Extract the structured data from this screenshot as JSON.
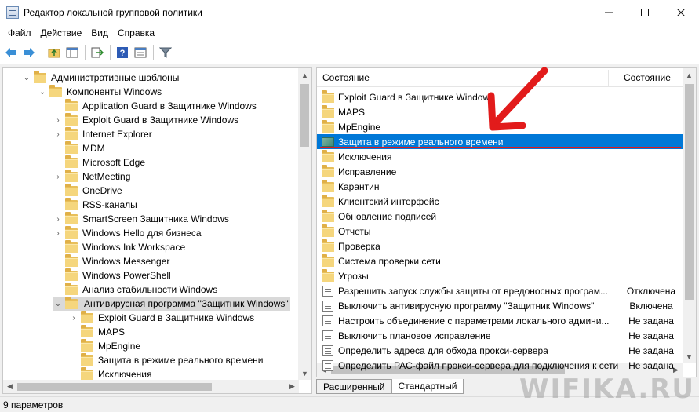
{
  "window": {
    "title": "Редактор локальной групповой политики",
    "controls": [
      "minimize-icon",
      "maximize-icon",
      "close-icon"
    ]
  },
  "menu": [
    "Файл",
    "Действие",
    "Вид",
    "Справка"
  ],
  "toolbar": [
    "back-arrow-icon",
    "forward-arrow-icon",
    "up-folder-icon",
    "console-tree-icon",
    "export-list-icon",
    "help-icon",
    "properties-icon",
    "filter-icon"
  ],
  "tree": [
    {
      "label": "Административные шаблоны",
      "expander": "⌄",
      "level": 0
    },
    {
      "label": "Компоненты Windows",
      "expander": "⌄",
      "level": 1
    },
    {
      "label": "Application Guard в Защитнике Windows",
      "expander": "",
      "level": 2
    },
    {
      "label": "Exploit Guard в Защитнике Windows",
      "expander": "›",
      "level": 2
    },
    {
      "label": "Internet Explorer",
      "expander": "›",
      "level": 2
    },
    {
      "label": "MDM",
      "expander": "",
      "level": 2
    },
    {
      "label": "Microsoft Edge",
      "expander": "",
      "level": 2
    },
    {
      "label": "NetMeeting",
      "expander": "›",
      "level": 2
    },
    {
      "label": "OneDrive",
      "expander": "",
      "level": 2
    },
    {
      "label": "RSS-каналы",
      "expander": "",
      "level": 2
    },
    {
      "label": "SmartScreen Защитника Windows",
      "expander": "›",
      "level": 2
    },
    {
      "label": "Windows Hello для бизнеса",
      "expander": "›",
      "level": 2
    },
    {
      "label": "Windows Ink Workspace",
      "expander": "",
      "level": 2
    },
    {
      "label": "Windows Messenger",
      "expander": "",
      "level": 2
    },
    {
      "label": "Windows PowerShell",
      "expander": "",
      "level": 2
    },
    {
      "label": "Анализ стабильности Windows",
      "expander": "",
      "level": 2
    },
    {
      "label": "Антивирусная программа \"Защитник Windows\"",
      "expander": "⌄",
      "level": 2,
      "selected": true
    },
    {
      "label": "Exploit Guard в Защитнике Windows",
      "expander": "›",
      "level": 3
    },
    {
      "label": "MAPS",
      "expander": "",
      "level": 3
    },
    {
      "label": "MpEngine",
      "expander": "",
      "level": 3
    },
    {
      "label": "Защита в режиме реального времени",
      "expander": "",
      "level": 3
    },
    {
      "label": "Исключения",
      "expander": "",
      "level": 3
    }
  ],
  "list": {
    "columns": [
      "Состояние",
      "Состояние"
    ],
    "rows": [
      {
        "name": "Exploit Guard в Защитнике Windows",
        "state": "",
        "kind": "folder"
      },
      {
        "name": "MAPS",
        "state": "",
        "kind": "folder"
      },
      {
        "name": "MpEngine",
        "state": "",
        "kind": "folder"
      },
      {
        "name": "Защита в режиме реального времени",
        "state": "",
        "kind": "selected-folder"
      },
      {
        "name": "Исключения",
        "state": "",
        "kind": "folder"
      },
      {
        "name": "Исправление",
        "state": "",
        "kind": "folder"
      },
      {
        "name": "Карантин",
        "state": "",
        "kind": "folder"
      },
      {
        "name": "Клиентский интерфейс",
        "state": "",
        "kind": "folder"
      },
      {
        "name": "Обновление подписей",
        "state": "",
        "kind": "folder"
      },
      {
        "name": "Отчеты",
        "state": "",
        "kind": "folder"
      },
      {
        "name": "Проверка",
        "state": "",
        "kind": "folder"
      },
      {
        "name": "Система проверки сети",
        "state": "",
        "kind": "folder"
      },
      {
        "name": "Угрозы",
        "state": "",
        "kind": "folder"
      },
      {
        "name": "Разрешить запуск службы защиты от вредоносных програм...",
        "state": "Отключена",
        "kind": "policy"
      },
      {
        "name": "Выключить антивирусную программу \"Защитник Windows\"",
        "state": "Включена",
        "kind": "policy"
      },
      {
        "name": "Настроить объединение с параметрами локального админи...",
        "state": "Не задана",
        "kind": "policy"
      },
      {
        "name": "Выключить плановое исправление",
        "state": "Не задана",
        "kind": "policy"
      },
      {
        "name": "Определить адреса для обхода прокси-сервера",
        "state": "Не задана",
        "kind": "policy"
      },
      {
        "name": "Определить PAC-файл прокси-сервера для подключения к сети",
        "state": "Не задана",
        "kind": "policy"
      }
    ]
  },
  "tabs": [
    {
      "label": "Расширенный",
      "active": false
    },
    {
      "label": "Стандартный",
      "active": true
    }
  ],
  "status": "9 параметров",
  "watermark": "WIFIKA.RU",
  "colors": {
    "selection": "#0078d7",
    "annotation": "#e21b1b",
    "tree_selection": "#d9d9d9"
  }
}
